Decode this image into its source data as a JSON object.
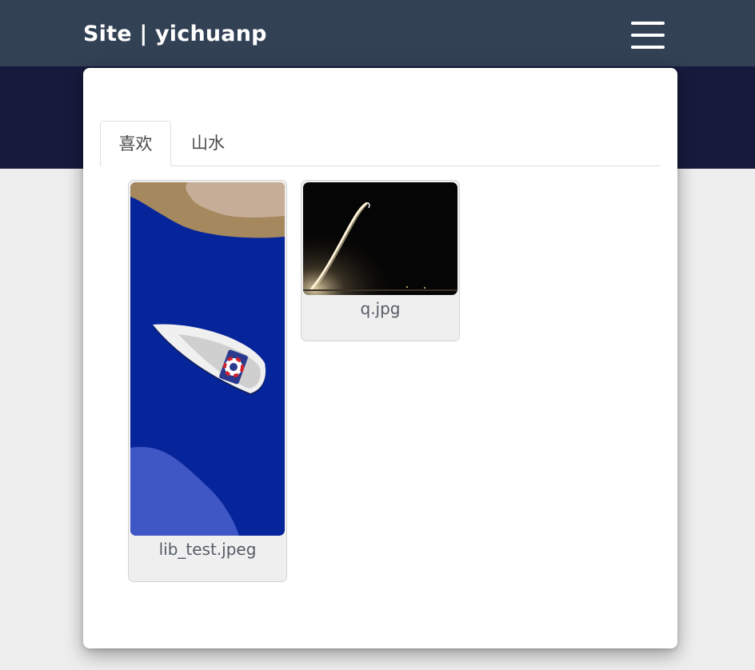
{
  "header": {
    "brand": "Site | yichuanp",
    "menu_icon": "hamburger-menu-icon",
    "background": "#334155"
  },
  "hero": {
    "background": "#171a3c"
  },
  "tabs": [
    {
      "label": "喜欢",
      "active": true
    },
    {
      "label": "山水",
      "active": false
    }
  ],
  "gallery": {
    "items": [
      {
        "filename": "lib_test.jpeg",
        "image": "boat-illustration"
      },
      {
        "filename": "q.jpg",
        "image": "rocket-launch-photo"
      }
    ]
  }
}
